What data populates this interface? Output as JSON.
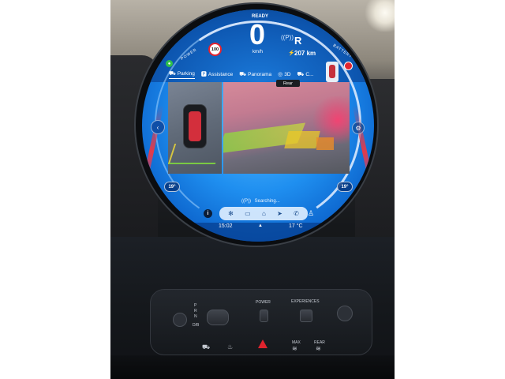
{
  "display": {
    "status": "READY",
    "speed": "0",
    "speed_unit": "km/h",
    "power_label": "POWER",
    "battery_label": "BATTERY",
    "speed_limit": "100",
    "gear": "R",
    "range": "207 km"
  },
  "tabs": [
    {
      "label": "Parking",
      "icon": "parking-car-icon",
      "active": true
    },
    {
      "label": "Assistance",
      "icon": "p-sign-icon",
      "active": false
    },
    {
      "label": "Panorama",
      "icon": "panorama-car-icon",
      "active": false
    },
    {
      "label": "3D",
      "icon": "3d-icon",
      "active": false
    },
    {
      "label": "C...",
      "icon": "car-icon",
      "active": false
    }
  ],
  "camera": {
    "rear_label": "Rear"
  },
  "climate": {
    "left_temp": "19°",
    "right_temp": "19°"
  },
  "status_bar": {
    "parking_status": "Searching..."
  },
  "dock": {
    "items": [
      "fan-icon",
      "card-icon",
      "home-icon",
      "navigation-icon",
      "phone-icon"
    ]
  },
  "footer": {
    "time": "15:02",
    "outside_temp": "17 °C"
  },
  "console": {
    "gear_labels": [
      "P",
      "R",
      "N",
      "D/B"
    ],
    "power_label": "POWER",
    "experiences_label": "EXPERIENCES",
    "max_label": "MAX",
    "rear_label": "REAR"
  },
  "colors": {
    "screen_blue": "#1f8ff0",
    "alert_red": "#e3232f",
    "parking_ok_green": "#2fbf4a"
  }
}
